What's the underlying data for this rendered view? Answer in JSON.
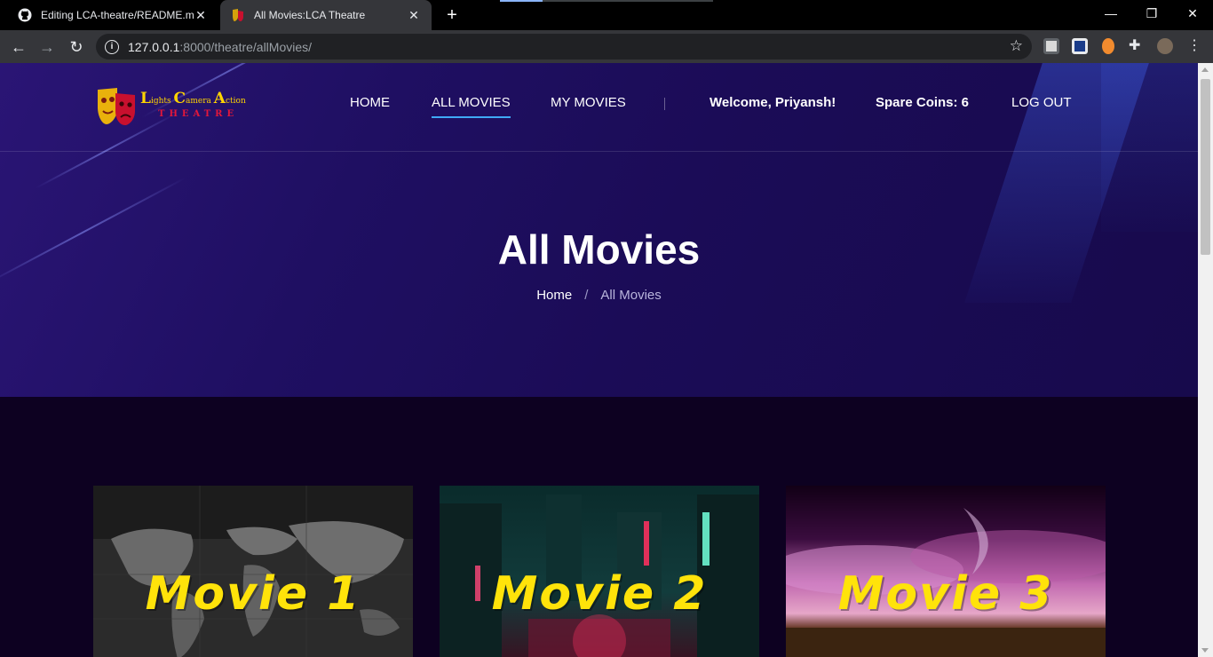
{
  "browser": {
    "tabs": [
      {
        "title": "Editing LCA-theatre/README.md",
        "icon": "github-icon",
        "active": false
      },
      {
        "title": "All Movies:LCA Theatre",
        "icon": "theatre-mask-icon",
        "active": true
      }
    ],
    "new_tab": "+",
    "window_controls": {
      "minimize": "—",
      "restore": "❐",
      "close": "✕"
    },
    "url_host": "127.0.0.1",
    "url_rest": ":8000/theatre/allMovies/"
  },
  "site": {
    "logo": {
      "line1_parts": [
        "L",
        "ights ",
        "C",
        "amera ",
        "A",
        "ction"
      ],
      "line2": "THEATRE"
    },
    "nav": {
      "home": "HOME",
      "all_movies": "ALL MOVIES",
      "my_movies": "MY MOVIES",
      "welcome": "Welcome, Priyansh!",
      "coins": "Spare Coins: 6",
      "logout": "LOG OUT"
    },
    "page_title": "All Movies",
    "breadcrumb": {
      "home": "Home",
      "separator": "/",
      "current": "All Movies"
    },
    "movies": [
      {
        "label": "Movie 1",
        "theme": "world-map"
      },
      {
        "label": "Movie 2",
        "theme": "neon-city"
      },
      {
        "label": "Movie 3",
        "theme": "pink-sky"
      }
    ],
    "colors": {
      "accent_underline": "#3fa9f5",
      "movie_label": "#ffe30a",
      "hero_bg": "#1f0f62",
      "page_bg": "#0d0121"
    }
  }
}
